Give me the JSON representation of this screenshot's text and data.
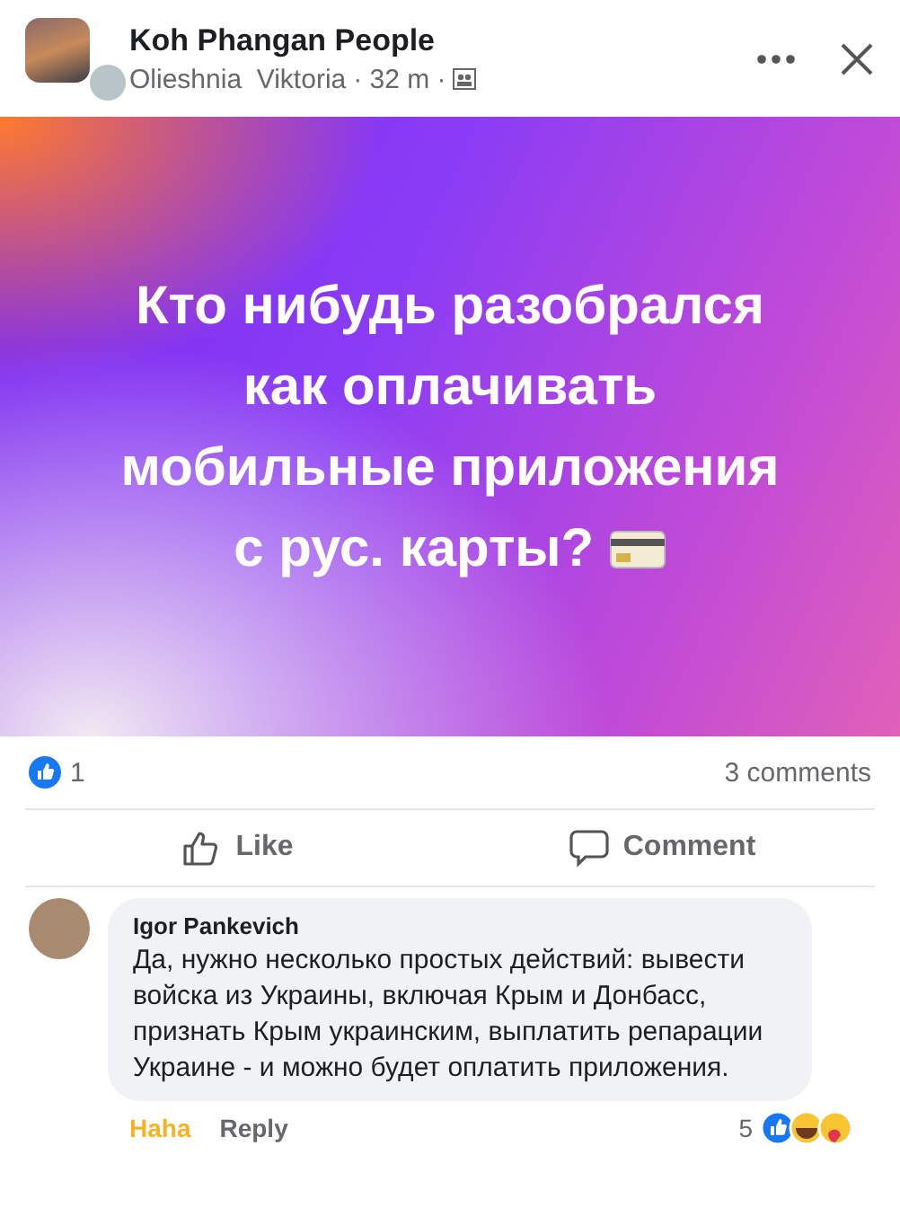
{
  "header": {
    "group_name": "Koh Phangan People",
    "author": "Olieshnia  Viktoria",
    "time": "· 32 m ·"
  },
  "post": {
    "text": "Кто нибудь разобрался как оплачивать мобильные приложения с рус. карты?"
  },
  "stats": {
    "likes": "1",
    "comments": "3 comments"
  },
  "actions": [
    {
      "kind": "like",
      "label": "Like"
    },
    {
      "kind": "comment",
      "label": "Comment"
    }
  ],
  "comment": {
    "author": "Igor Pankevich",
    "text": "Да, нужно несколько простых действий: вывести войска из Украины, включая Крым и Донбасс, признать Крым украинским, выплатить репарации Украине - и можно будет оплатить приложения.",
    "reaction_button": {
      "label": "Haha",
      "selected": true
    },
    "reply": "Reply",
    "reaction_count": "5"
  }
}
